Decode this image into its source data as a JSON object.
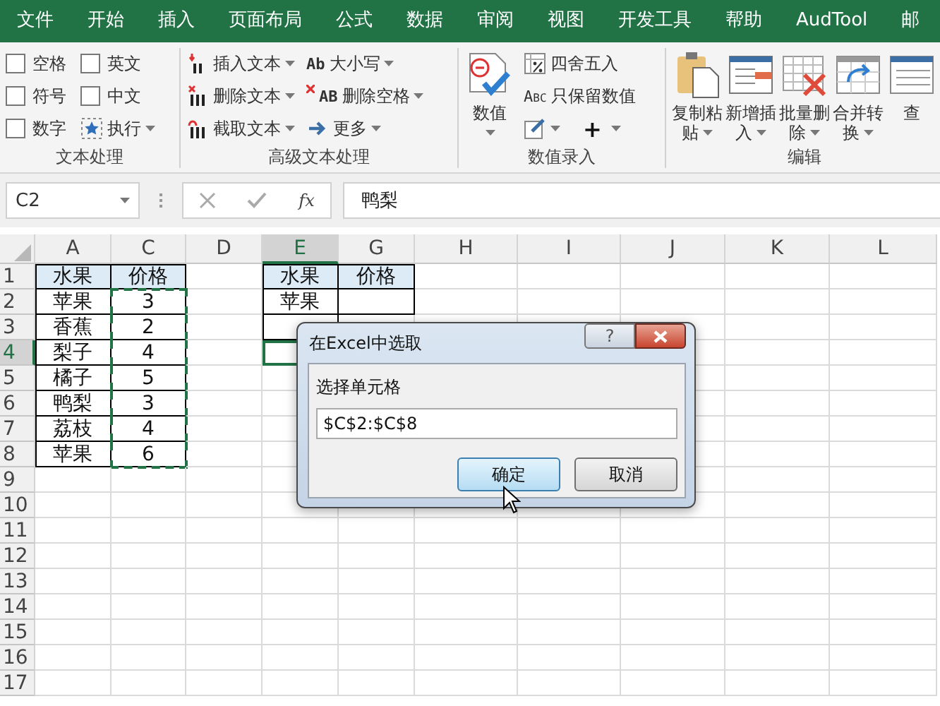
{
  "tabs": [
    "文件",
    "开始",
    "插入",
    "页面布局",
    "公式",
    "数据",
    "审阅",
    "视图",
    "开发工具",
    "帮助",
    "AudTool",
    "邮"
  ],
  "ribbon": {
    "groups": [
      {
        "label": "文本处理",
        "columns": [
          [
            {
              "kind": "checkbox",
              "label": "空格",
              "checked": false
            },
            {
              "kind": "checkbox",
              "label": "符号",
              "checked": false
            },
            {
              "kind": "checkbox",
              "label": "数字",
              "checked": false
            }
          ],
          [
            {
              "kind": "checkbox",
              "label": "英文",
              "checked": false
            },
            {
              "kind": "checkbox",
              "label": "中文",
              "checked": false
            },
            {
              "kind": "small",
              "label": "执行",
              "dropdown": true
            }
          ]
        ]
      },
      {
        "label": "高级文本处理",
        "columns": [
          [
            {
              "kind": "small",
              "label": "插入文本",
              "dropdown": true
            },
            {
              "kind": "small",
              "label": "删除文本",
              "dropdown": true
            },
            {
              "kind": "small",
              "label": "截取文本",
              "dropdown": true
            }
          ],
          [
            {
              "kind": "small",
              "glyph": "Ab",
              "label": "大小写",
              "dropdown": true
            },
            {
              "kind": "small",
              "glyph": "AB",
              "label": "删除空格",
              "dropdown": true
            },
            {
              "kind": "small",
              "label": "更多",
              "dropdown": true
            }
          ]
        ]
      },
      {
        "label": "数值录入",
        "columns": [
          [
            {
              "kind": "large",
              "lines": [
                "数值"
              ],
              "dropdown": true
            }
          ],
          [
            {
              "kind": "small",
              "label": "四舍五入",
              "dropdown": false
            },
            {
              "kind": "small",
              "glyph": "Abc",
              "label": "只保留数值",
              "dropdown": false
            },
            {
              "kind": "row",
              "items": [
                {
                  "kind": "menu",
                  "dropdown": true
                },
                {
                  "kind": "menu",
                  "glyph": "+",
                  "dropdown": true
                }
              ]
            }
          ]
        ]
      },
      {
        "label": "编辑",
        "columns": [
          [
            {
              "kind": "large",
              "lines": [
                "复制粘",
                "贴"
              ],
              "dropdown": true
            }
          ],
          [
            {
              "kind": "large",
              "lines": [
                "新增插",
                "入"
              ],
              "dropdown": true
            }
          ],
          [
            {
              "kind": "large",
              "lines": [
                "批量删",
                "除"
              ],
              "dropdown": true
            }
          ],
          [
            {
              "kind": "large",
              "lines": [
                "合并转",
                "换"
              ],
              "dropdown": true
            }
          ],
          [
            {
              "kind": "large",
              "lines": [
                "查"
              ],
              "dropdown": false
            }
          ]
        ]
      }
    ]
  },
  "formula_bar": {
    "name_box": "C2",
    "fx": "fx",
    "formula": "鸭梨"
  },
  "sheet": {
    "columns": [
      {
        "label": "A",
        "selected": false
      },
      {
        "label": "C",
        "selected": false
      },
      {
        "label": "D",
        "selected": false
      },
      {
        "label": "E",
        "selected": true
      },
      {
        "label": "G",
        "selected": false
      },
      {
        "label": "H",
        "selected": false
      },
      {
        "label": "I",
        "selected": false
      },
      {
        "label": "J",
        "selected": false
      },
      {
        "label": "K",
        "selected": false
      },
      {
        "label": "L",
        "selected": false
      }
    ],
    "rows": [
      {
        "label": "1",
        "selected": false,
        "cells": [
          {
            "text": "水果",
            "kind": "header"
          },
          {
            "text": "价格",
            "kind": "header"
          },
          {},
          {
            "text": "水果",
            "kind": "header"
          },
          {
            "text": "价格",
            "kind": "header"
          }
        ]
      },
      {
        "label": "2",
        "selected": false,
        "cells": [
          {
            "text": "苹果",
            "kind": "value"
          },
          {
            "text": "3",
            "kind": "value",
            "marquee": true
          },
          {},
          {
            "text": "苹果",
            "kind": "value"
          },
          {
            "kind": "blank"
          }
        ]
      },
      {
        "label": "3",
        "selected": false,
        "cells": [
          {
            "text": "香蕉",
            "kind": "value"
          },
          {
            "text": "2",
            "kind": "value",
            "marquee": true
          },
          {},
          {
            "kind": "blank"
          }
        ]
      },
      {
        "label": "4",
        "selected": true,
        "cells": [
          {
            "text": "梨子",
            "kind": "value"
          },
          {
            "text": "4",
            "kind": "value",
            "marquee": true
          },
          {},
          {
            "kind": "blank",
            "active": true
          }
        ]
      },
      {
        "label": "5",
        "selected": false,
        "cells": [
          {
            "text": "橘子",
            "kind": "value"
          },
          {
            "text": "5",
            "kind": "value",
            "marquee": true
          }
        ]
      },
      {
        "label": "6",
        "selected": false,
        "cells": [
          {
            "text": "鸭梨",
            "kind": "value"
          },
          {
            "text": "3",
            "kind": "value",
            "marquee": true
          }
        ]
      },
      {
        "label": "7",
        "selected": false,
        "cells": [
          {
            "text": "荔枝",
            "kind": "value"
          },
          {
            "text": "4",
            "kind": "value",
            "marquee": true
          }
        ]
      },
      {
        "label": "8",
        "selected": false,
        "cells": [
          {
            "text": "苹果",
            "kind": "value"
          },
          {
            "text": "6",
            "kind": "value",
            "marquee": true
          }
        ]
      },
      {
        "label": "9",
        "selected": false
      },
      {
        "label": "10",
        "selected": false
      },
      {
        "label": "11",
        "selected": false
      },
      {
        "label": "12",
        "selected": false
      },
      {
        "label": "13",
        "selected": false
      },
      {
        "label": "14",
        "selected": false
      },
      {
        "label": "15",
        "selected": false
      },
      {
        "label": "16",
        "selected": false
      },
      {
        "label": "17",
        "selected": false
      }
    ]
  },
  "dialog": {
    "title": "在Excel中选取",
    "help": "?",
    "label": "选择单元格",
    "value": "$C$2:$C$8",
    "buttons": [
      {
        "label": "确定",
        "default": true
      },
      {
        "label": "取消",
        "default": false
      }
    ]
  }
}
